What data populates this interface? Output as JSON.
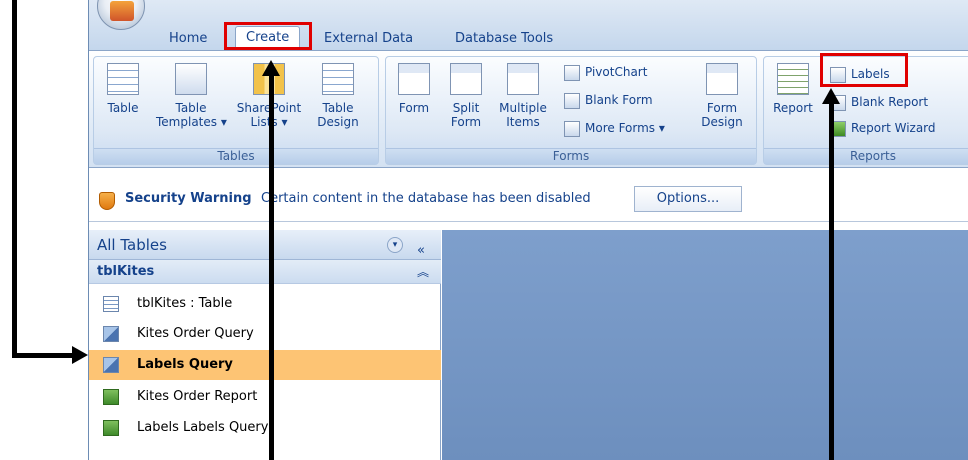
{
  "tabs": [
    {
      "label": "Home"
    },
    {
      "label": "Create"
    },
    {
      "label": "External Data"
    },
    {
      "label": "Database Tools"
    }
  ],
  "ribbon": {
    "tables": {
      "group_label": "Tables",
      "table": "Table",
      "table_templates": "Table\nTemplates ▾",
      "sharepoint": "SharePoint\nLists ▾",
      "table_design": "Table\nDesign"
    },
    "forms": {
      "group_label": "Forms",
      "form": "Form",
      "split_form": "Split\nForm",
      "multiple_items": "Multiple\nItems",
      "pivotchart": "PivotChart",
      "blank_form": "Blank Form",
      "more_forms": "More Forms ▾",
      "form_design": "Form\nDesign"
    },
    "reports": {
      "group_label": "Reports",
      "report": "Report",
      "labels": "Labels",
      "blank_report": "Blank Report",
      "report_wizard": "Report Wizard"
    }
  },
  "security": {
    "title": "Security Warning",
    "message": "Certain content in the database has been disabled",
    "button": "Options..."
  },
  "nav": {
    "header": "All Tables",
    "group": "tblKites",
    "items": [
      {
        "label": "tblKites : Table",
        "icon": "table-icon"
      },
      {
        "label": "Kites Order Query",
        "icon": "query-icon"
      },
      {
        "label": "Labels Query",
        "icon": "query-icon"
      },
      {
        "label": "Kites Order Report",
        "icon": "report-icon"
      },
      {
        "label": "Labels Labels Query",
        "icon": "report-icon"
      }
    ]
  }
}
